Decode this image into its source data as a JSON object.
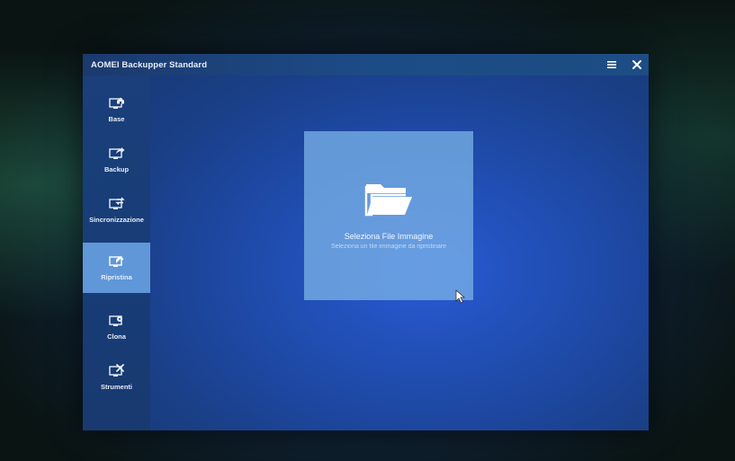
{
  "window": {
    "title": "AOMEI Backupper Standard",
    "menu_icon": "hamburger-menu-icon",
    "close_icon": "close-icon"
  },
  "sidebar": {
    "items": [
      {
        "label": "Base",
        "icon": "monitor-home-icon",
        "active": false
      },
      {
        "label": "Backup",
        "icon": "monitor-export-icon",
        "active": false
      },
      {
        "label": "Sincronizzazione",
        "icon": "monitor-sync-icon",
        "active": false
      },
      {
        "label": "Ripristina",
        "icon": "monitor-restore-icon",
        "active": true
      },
      {
        "label": "Clona",
        "icon": "monitor-clone-icon",
        "active": false
      },
      {
        "label": "Strumenti",
        "icon": "monitor-tools-icon",
        "active": false
      }
    ]
  },
  "main": {
    "card": {
      "icon": "folder-open-icon",
      "title": "Seleziona File Immagine",
      "subtitle": "Seleziona un file immagine da ripristinare"
    }
  },
  "colors": {
    "titlebar": "#1d4b86",
    "sidebar": "#173c76",
    "active_item": "#5f97d9",
    "content": "#2150b8",
    "card": "#78afe6"
  }
}
